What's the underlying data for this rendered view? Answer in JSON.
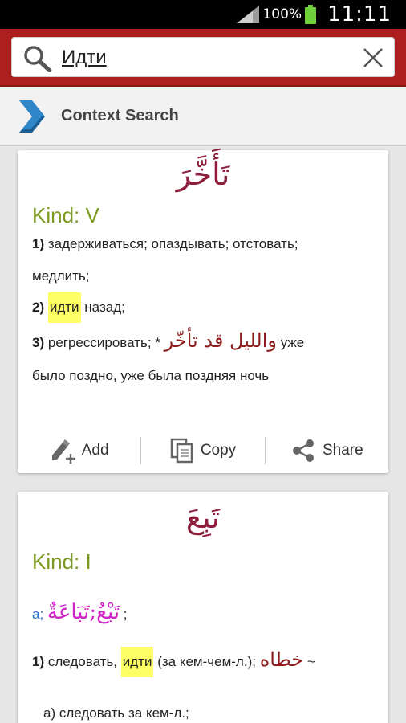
{
  "status": {
    "battery": "100%",
    "time": "11:11"
  },
  "search": {
    "value": "Идти",
    "placeholder": ""
  },
  "context": {
    "title": "Context Search"
  },
  "entries": [
    {
      "word": "تَأَخَّرَ",
      "kind": "Kind: V",
      "def1_num": "1)",
      "def1_text_a": "задерживаться; опаздывать; отстовать;",
      "def1_text_b": "медлить;",
      "def2_num": "2)",
      "def2_hl": "идти",
      "def2_rest": "назад;",
      "def3_num": "3)",
      "def3_text": "регрессировать; *",
      "def3_ar": "والليل قد تأخّر",
      "def3_after": "уже",
      "def3_text_b": "было поздно, уже была поздняя ночь",
      "actions": {
        "add": "Add",
        "copy": "Copy",
        "share": "Share"
      }
    },
    {
      "word": "تَبِعَ",
      "kind": "Kind: I",
      "forms_a": "a;",
      "forms_ar": "تَبْعٌ;تَبَاعَةٌ",
      "forms_end": ";",
      "def1_num": "1)",
      "def1_text": "следовать,",
      "def1_hl": "идти",
      "def1_rest": "(за кем-чем-л.);",
      "def1_ar": "خطاه",
      "def1_tilde": "~",
      "def1_sub": "а) следовать за кем-л.;"
    }
  ],
  "colors": {
    "header": "#ad1f1f",
    "arabic": "#8e1d3b",
    "kind": "#7b9a1e",
    "highlight": "#ffff66"
  }
}
